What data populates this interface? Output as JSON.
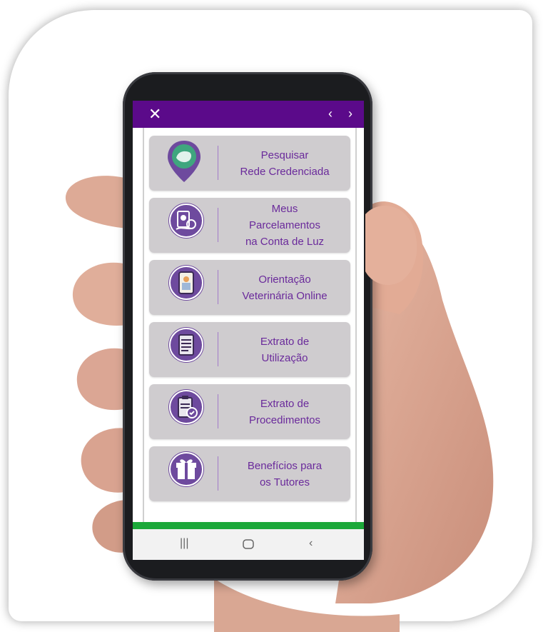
{
  "window": {
    "close_icon": "close-icon",
    "prev_icon": "chevron-left-icon",
    "next_icon": "chevron-right-icon"
  },
  "menu": [
    {
      "icon": "location-pin-pet-icon",
      "lines": [
        "Pesquisar",
        "Rede Credenciada"
      ]
    },
    {
      "icon": "pet-payment-icon",
      "lines": [
        "Meus",
        "Parcelamentos",
        "na Conta de Luz"
      ]
    },
    {
      "icon": "vet-video-call-icon",
      "lines": [
        "Orientação",
        "Veterinária Online"
      ]
    },
    {
      "icon": "usage-statement-icon",
      "lines": [
        "Extrato de",
        "Utilização"
      ]
    },
    {
      "icon": "procedures-clipboard-icon",
      "lines": [
        "Extrato de",
        "Procedimentos"
      ]
    },
    {
      "icon": "gift-icon",
      "lines": [
        "Benefícios para",
        "os Tutores"
      ]
    }
  ],
  "colors": {
    "topbar": "#5b0a8a",
    "accent_text": "#6a2a9b",
    "icon_bg": "#6e4a9e",
    "card_bg": "#cfcccf",
    "status_green": "#1ba839"
  },
  "android_nav": {
    "recents_icon": "recents-icon",
    "home_icon": "home-icon",
    "back_icon": "back-icon"
  }
}
